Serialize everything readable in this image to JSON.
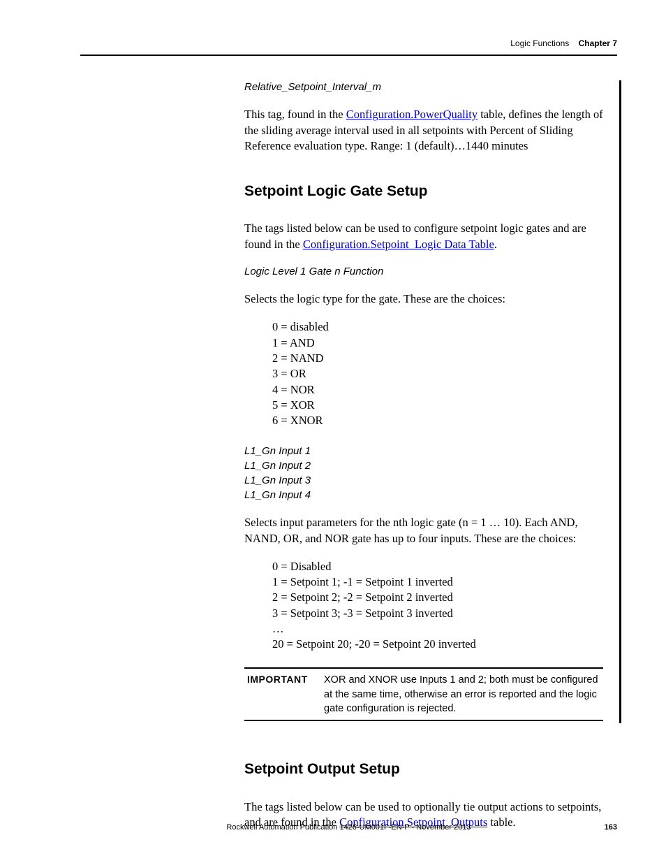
{
  "header": {
    "section": "Logic Functions",
    "chapter": "Chapter 7"
  },
  "sub1": {
    "title": "Relative_Setpoint_Interval_m",
    "p1a": "This tag, found in the ",
    "link1": "Configuration.PowerQuality",
    "p1b": " table, defines the length of the sliding average interval used in all setpoints with Percent of Sliding Reference evaluation type. Range: 1 (default)…1440 minutes"
  },
  "h2a": "Setpoint Logic Gate Setup",
  "sub2": {
    "p1a": "The tags listed below can be used to configure setpoint logic gates and are found in the ",
    "link1": "Configuration.Setpoint_Logic Data Table",
    "p1b": "."
  },
  "sub3": {
    "title": "Logic Level 1 Gate n Function",
    "p1": "Selects the logic type for the gate. These are the choices:",
    "choices": [
      "0 = disabled",
      "1 = AND",
      "2 = NAND",
      "3 = OR",
      "4 = NOR",
      "5 = XOR",
      "6 = XNOR"
    ]
  },
  "gateInputs": [
    "L1_Gn Input 1",
    "L1_Gn Input 2",
    "L1_Gn Input 3",
    "L1_Gn Input 4"
  ],
  "sub4": {
    "p1": "Selects input parameters for the nth logic gate (n = 1 … 10).  Each AND, NAND, OR, and NOR gate has up to four inputs. These are the choices:",
    "choices": [
      "0 = Disabled",
      "1 = Setpoint 1; -1 = Setpoint 1 inverted",
      "2 = Setpoint 2; -2 = Setpoint 2 inverted",
      "3 = Setpoint 3; -3 = Setpoint 3 inverted",
      "…",
      "20 = Setpoint 20; -20 = Setpoint 20 inverted"
    ]
  },
  "important": {
    "label": "IMPORTANT",
    "text": "XOR and XNOR use Inputs 1 and 2; both must be configured at the same time, otherwise an error is reported and the logic gate configuration is rejected."
  },
  "h2b": "Setpoint Output Setup",
  "sub5": {
    "p1a": "The tags listed below can be used to optionally tie output actions to setpoints, and are found in the ",
    "link1": "Configuration.Setpoint_Outputs",
    "p1b": " table."
  },
  "footer": {
    "text": "Rockwell Automation Publication 1426-UM001F-EN-P - November 2013",
    "page": "163"
  }
}
